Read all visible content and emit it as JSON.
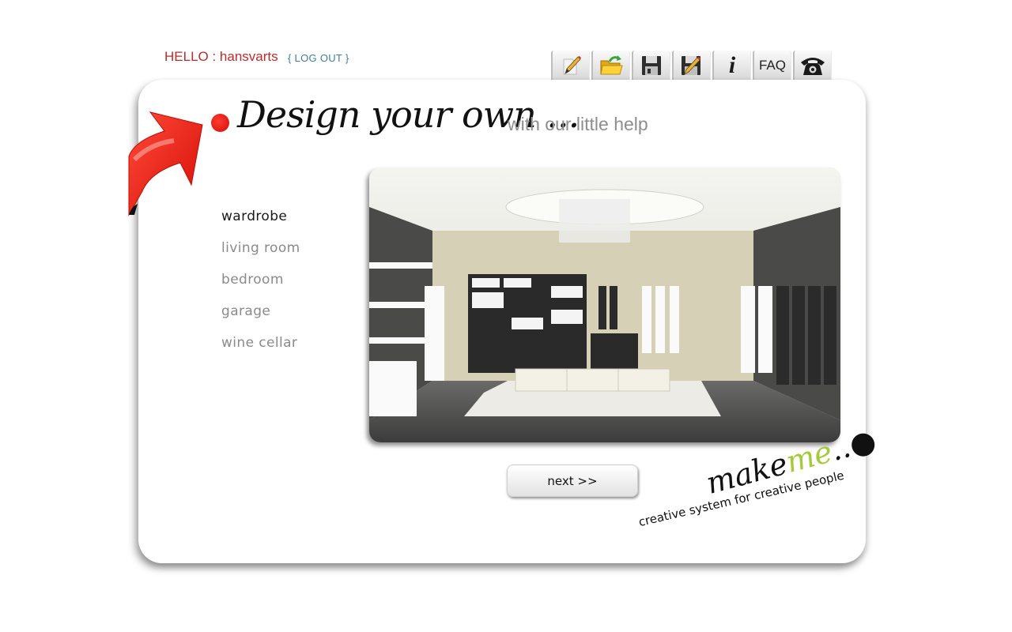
{
  "header": {
    "greeting_prefix": "HELLO : ",
    "username": "hansvarts",
    "logout_label": "{ LOG OUT }"
  },
  "toolbar": {
    "items": [
      {
        "name": "edit",
        "icon": "pencil-icon"
      },
      {
        "name": "open",
        "icon": "folder-open-icon"
      },
      {
        "name": "save",
        "icon": "floppy-disk-icon"
      },
      {
        "name": "save-as",
        "icon": "floppy-pencil-icon"
      },
      {
        "name": "info",
        "icon": "info-icon",
        "label": "i"
      },
      {
        "name": "faq",
        "icon": "faq-icon",
        "label": "FAQ"
      },
      {
        "name": "contact",
        "icon": "telephone-icon"
      }
    ]
  },
  "hero": {
    "title": "Design your own ...",
    "subtitle": "with our little help"
  },
  "menu": {
    "items": [
      {
        "label": "wardrobe",
        "active": true
      },
      {
        "label": "living room",
        "active": false
      },
      {
        "label": "bedroom",
        "active": false
      },
      {
        "label": "garage",
        "active": false
      },
      {
        "label": "wine cellar",
        "active": false
      }
    ]
  },
  "preview": {
    "alt": "wardrobe room render"
  },
  "actions": {
    "next_label": "next >>"
  },
  "brand": {
    "word_make": "make",
    "word_me": "me",
    "dots": "..",
    "tagline": "creative system for creative people",
    "accent_color": "#a6c93a",
    "red": "#e8140c"
  }
}
